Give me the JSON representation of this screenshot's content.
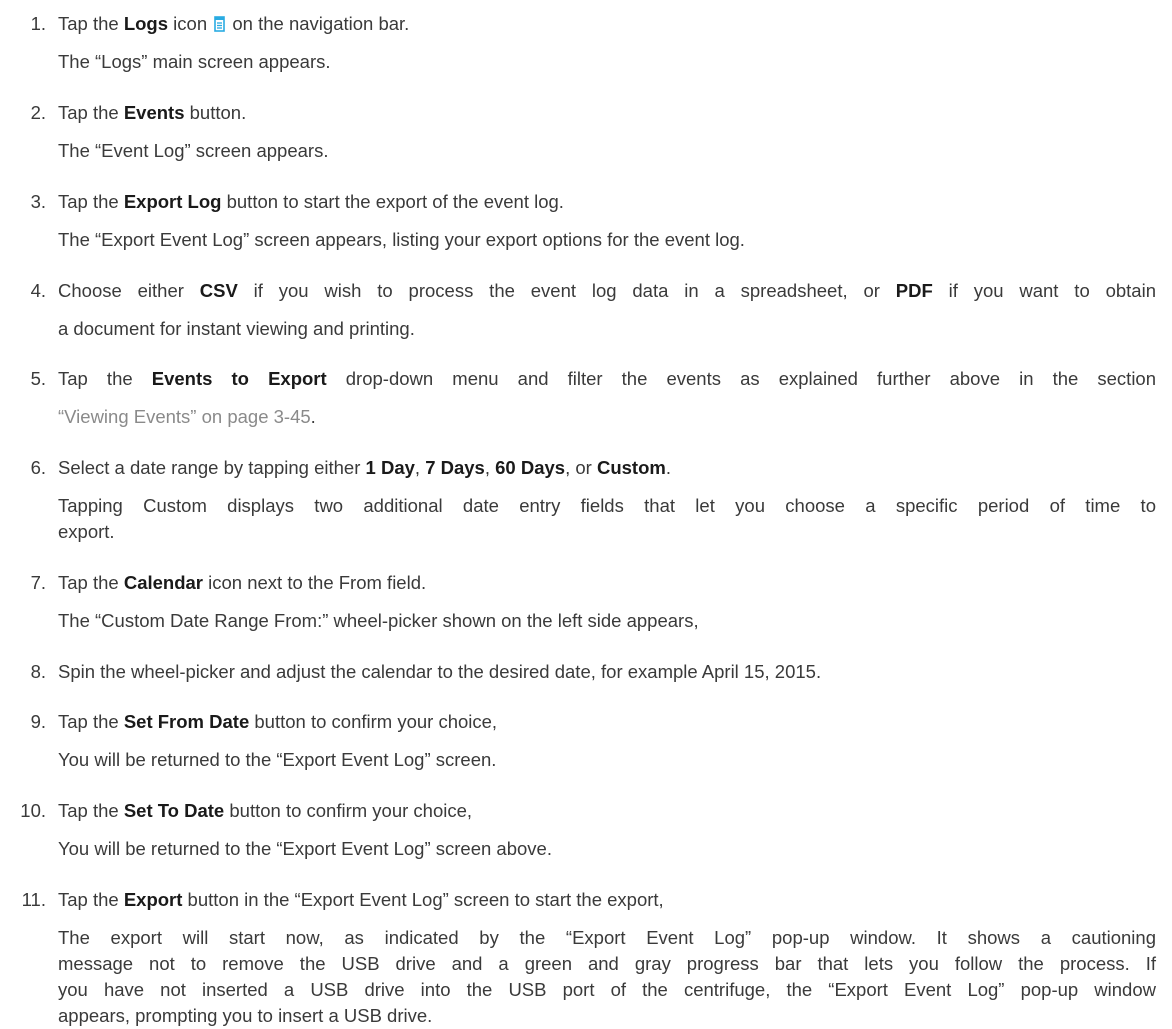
{
  "steps": [
    {
      "num": "1.",
      "a": "Tap the ",
      "b": "Logs",
      "c": " icon ",
      "icon": "logs-icon",
      "d": " on the navigation bar.",
      "result": "The “Logs” main screen appears."
    },
    {
      "num": "2.",
      "a": "Tap the ",
      "b": "Events",
      "c": " button.",
      "result": "The “Event Log” screen appears."
    },
    {
      "num": "3.",
      "a": "Tap the ",
      "b": "Export Log",
      "c": " button to start the export of the event log.",
      "result": "The “Export Event Log” screen appears, listing your export options for the event log."
    },
    {
      "num": "4.",
      "a": "Choose either ",
      "b": "CSV",
      "c": " if you wish to process the event log data in a spreadsheet, or ",
      "d": "PDF",
      "e": " if you want to obtain",
      "line2": "a document for instant viewing and printing."
    },
    {
      "num": "5.",
      "a": "Tap the ",
      "b": "Events to Export",
      "c": " drop-down menu and filter the events as explained further above in the section",
      "link": "“Viewing Events” on page 3-45",
      "end": "."
    },
    {
      "num": "6.",
      "a": "Select a date range by tapping either ",
      "b": "1 Day",
      "c": ", ",
      "d": "7 Days",
      "e": ", ",
      "f": "60 Days",
      "g": ", or ",
      "h": "Custom",
      "i": ".",
      "result": "Tapping Custom displays two additional date entry fields that let you choose a specific period of time to",
      "result2": "export."
    },
    {
      "num": "7.",
      "a": "Tap the ",
      "b": "Calendar",
      "c": " icon next to the From field.",
      "result": "The “Custom Date Range From:” wheel-picker shown on the left side appears,"
    },
    {
      "num": "8.",
      "a": "Spin the wheel-picker and adjust the calendar to the desired date, for example April 15, 2015."
    },
    {
      "num": "9.",
      "a": "Tap the ",
      "b": "Set From Date",
      "c": " button to confirm your choice,",
      "result": "You will be returned to the “Export Event Log” screen."
    },
    {
      "num": "10.",
      "a": "Tap the ",
      "b": "Set To Date",
      "c": " button to confirm your choice,",
      "result": "You will be returned to the “Export Event Log” screen above."
    },
    {
      "num": "11.",
      "a": "Tap the ",
      "b": "Export",
      "c": " button in the “Export Event Log” screen to start the export,",
      "p1": "The export will start now, as indicated by the “Export Event Log” pop-up window. It shows a cautioning",
      "p2": "message not to remove the USB drive and a green and gray progress bar that lets you follow the process. If",
      "p3": "you have not inserted a USB drive into the USB port of the centrifuge, the “Export Event Log” pop-up window",
      "p4": "appears, prompting you to insert a USB drive."
    }
  ],
  "colors": {
    "text": "#3a3a3a",
    "bold": "#1a1a1a",
    "link": "#8a8a8a",
    "icon": "#29abe2"
  }
}
